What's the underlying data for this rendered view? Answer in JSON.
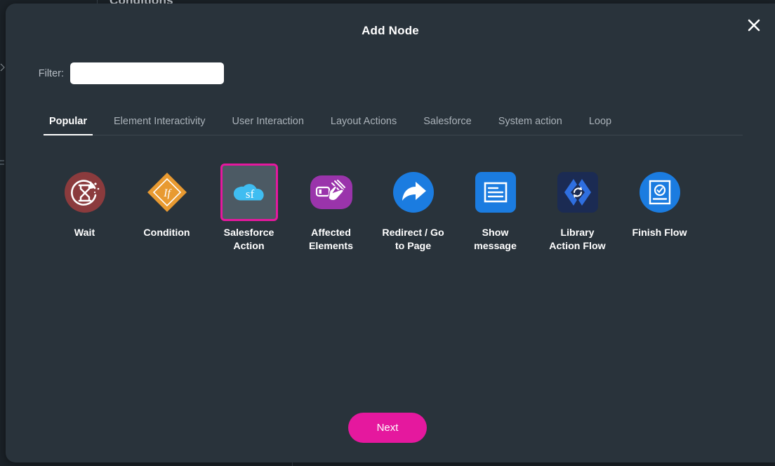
{
  "background": {
    "page_title": "Conditions"
  },
  "modal": {
    "title": "Add Node",
    "close_icon": "close-icon",
    "filter": {
      "label": "Filter:",
      "value": "",
      "placeholder": ""
    },
    "tabs": [
      {
        "label": "Popular",
        "active": true
      },
      {
        "label": "Element Interactivity",
        "active": false
      },
      {
        "label": "User Interaction",
        "active": false
      },
      {
        "label": "Layout Actions",
        "active": false
      },
      {
        "label": "Salesforce",
        "active": false
      },
      {
        "label": "System action",
        "active": false
      },
      {
        "label": "Loop",
        "active": false
      }
    ],
    "nodes": [
      {
        "label": "Wait",
        "icon": "hourglass-refresh-icon",
        "color": "#8b3b3d",
        "selected": false
      },
      {
        "label": "Condition",
        "icon": "diamond-if-icon",
        "color": "#e89a31",
        "selected": false
      },
      {
        "label": "Salesforce\nAction",
        "icon": "salesforce-cloud-icon",
        "color": "#3fbdf1",
        "selected": true
      },
      {
        "label": "Affected\nElements",
        "icon": "hand-pointer-icon",
        "color": "#9a34ab",
        "selected": false
      },
      {
        "label": "Redirect / Go\nto Page",
        "icon": "share-arrow-icon",
        "color": "#1b7ce0",
        "selected": false
      },
      {
        "label": "Show\nmessage",
        "icon": "message-document-icon",
        "color": "#1b7ce0",
        "selected": false
      },
      {
        "label": "Library\nAction Flow",
        "icon": "code-refresh-icon",
        "color": "#1b2b53",
        "selected": false
      },
      {
        "label": "Finish Flow",
        "icon": "checkbox-card-icon",
        "color": "#1b7ce0",
        "selected": false
      }
    ],
    "next_button": "Next"
  },
  "colors": {
    "modal_bg": "#29333b",
    "page_bg": "#1b2228",
    "accent": "#e5189e",
    "selected_border": "#e5189e"
  }
}
